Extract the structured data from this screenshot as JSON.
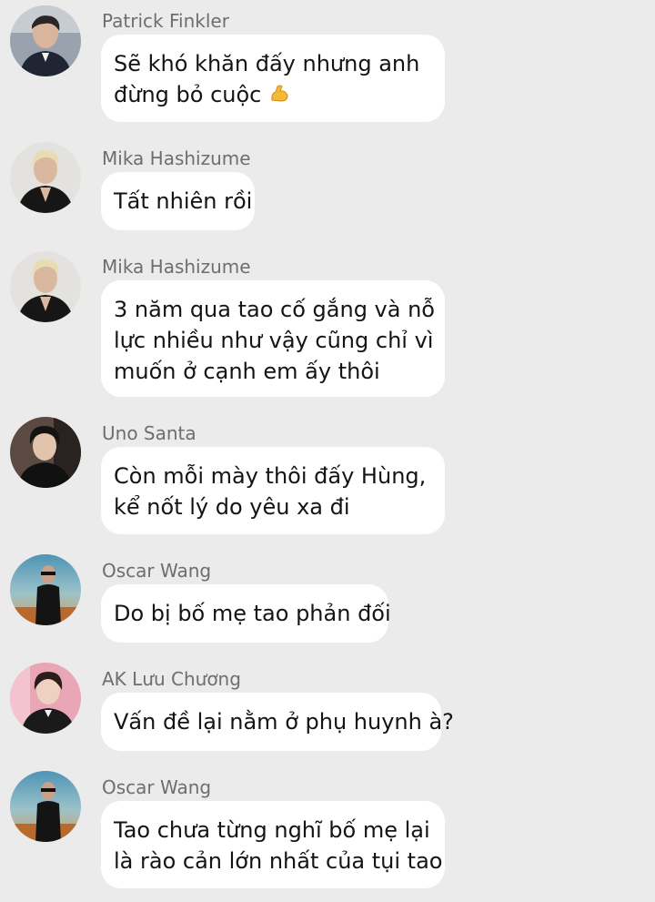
{
  "messages": [
    {
      "sender": "Patrick Finkler",
      "avatar": "avatar-patrick-finkler",
      "lines": [
        "Sẽ khó khăn đấy nhưng anh",
        "đừng bỏ cuộc"
      ],
      "emoji_icon": "flexed-biceps-icon"
    },
    {
      "sender": "Mika Hashizume",
      "avatar": "avatar-mika-hashizume",
      "lines": [
        "Tất nhiên rồi"
      ]
    },
    {
      "sender": "Mika Hashizume",
      "avatar": "avatar-mika-hashizume",
      "lines": [
        "3 năm qua tao cố gắng và nỗ",
        "lực nhiều như vậy cũng chỉ vì",
        "muốn ở cạnh em ấy thôi"
      ]
    },
    {
      "sender": "Uno Santa",
      "avatar": "avatar-uno-santa",
      "lines": [
        "Còn mỗi mày thôi đấy Hùng,",
        "kể nốt lý do yêu xa đi"
      ]
    },
    {
      "sender": "Oscar Wang",
      "avatar": "avatar-oscar-wang",
      "lines": [
        "Do bị bố mẹ tao phản đối"
      ]
    },
    {
      "sender": "AK Lưu Chương",
      "avatar": "avatar-ak-luu-chuong",
      "lines": [
        "Vấn đề lại nằm ở phụ huynh à?"
      ]
    },
    {
      "sender": "Oscar Wang",
      "avatar": "avatar-oscar-wang",
      "lines": [
        "Tao chưa từng nghĩ bố mẹ lại",
        "là rào cản lớn nhất của tụi tao"
      ]
    }
  ]
}
